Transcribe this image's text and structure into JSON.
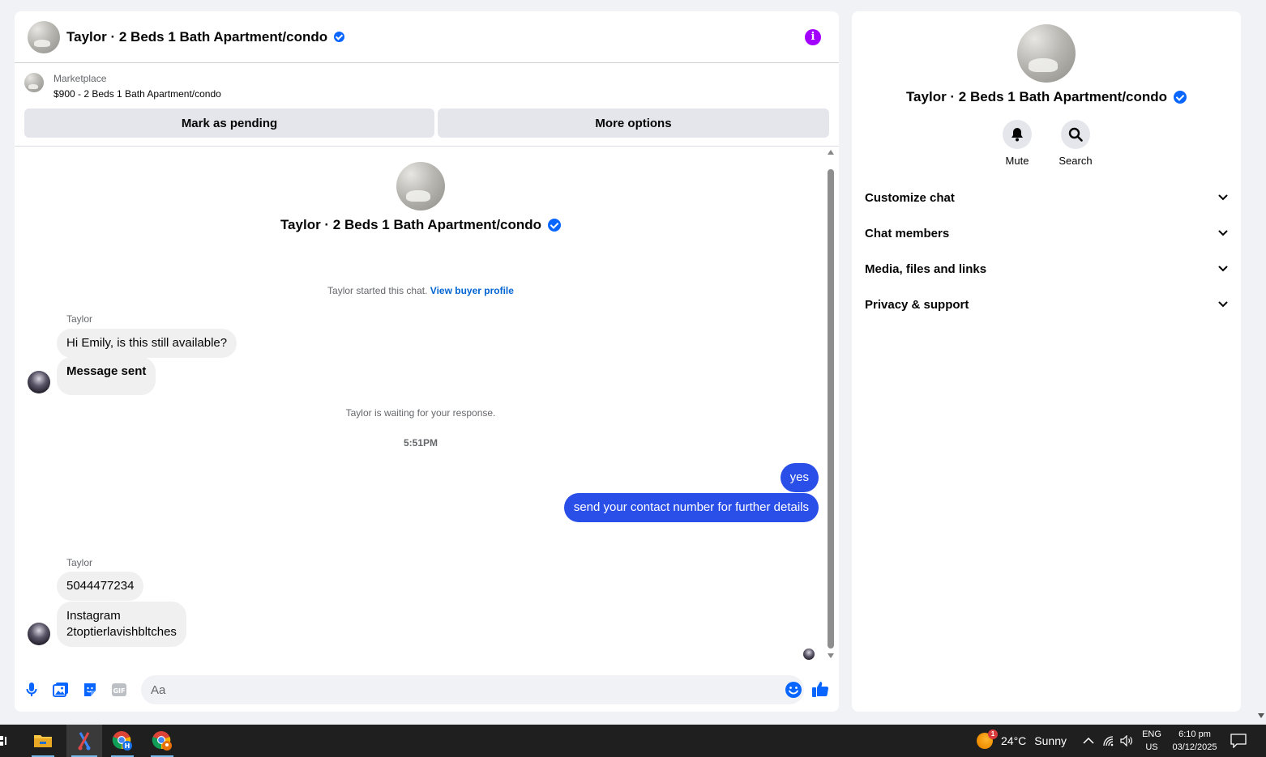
{
  "header": {
    "title": "Taylor · 2 Beds 1 Bath Apartment/condo"
  },
  "listing": {
    "label": "Marketplace",
    "title": "$900 - 2 Beds 1 Bath Apartment/condo"
  },
  "actions": {
    "pending_label": "Mark as pending",
    "more_label": "More options"
  },
  "conversation": {
    "intro_title": "Taylor · 2 Beds 1 Bath Apartment/condo",
    "started_text": "Taylor started this chat.",
    "view_profile_link": "View buyer profile",
    "waiting_text": "Taylor is waiting for your response.",
    "timestamp": "5:51PM",
    "groups": [
      {
        "sender": "Taylor",
        "messages": [
          "Hi Emily, is this still available?",
          "Message sent"
        ]
      },
      {
        "sender": "Taylor",
        "messages": [
          "5044477234",
          "Instagram",
          "2toptierlavishbltches"
        ]
      }
    ],
    "outgoing": [
      "yes",
      "send your contact number for further details"
    ]
  },
  "composer": {
    "placeholder": "Aa"
  },
  "details": {
    "title": "Taylor · 2 Beds 1 Bath Apartment/condo",
    "mute_label": "Mute",
    "search_label": "Search",
    "sections": [
      "Customize chat",
      "Chat members",
      "Media, files and links",
      "Privacy & support"
    ]
  },
  "taskbar": {
    "weather_temp": "24°C",
    "weather_text": "Sunny",
    "weather_badge": "1",
    "lang_top": "ENG",
    "lang_bottom": "US",
    "time": "6:10 pm",
    "date": "03/12/2025"
  },
  "colors": {
    "accent": "#0866ff",
    "outgoing_bubble": "#2a4ee8",
    "info": "#a200ff",
    "link": "#0064d1"
  },
  "icons": [
    "info-icon",
    "verified-icon",
    "mic-icon",
    "image-icon",
    "sticker-icon",
    "gif-icon",
    "emoji-icon",
    "like-icon",
    "bell-icon",
    "search-icon",
    "chevron-down-icon"
  ]
}
